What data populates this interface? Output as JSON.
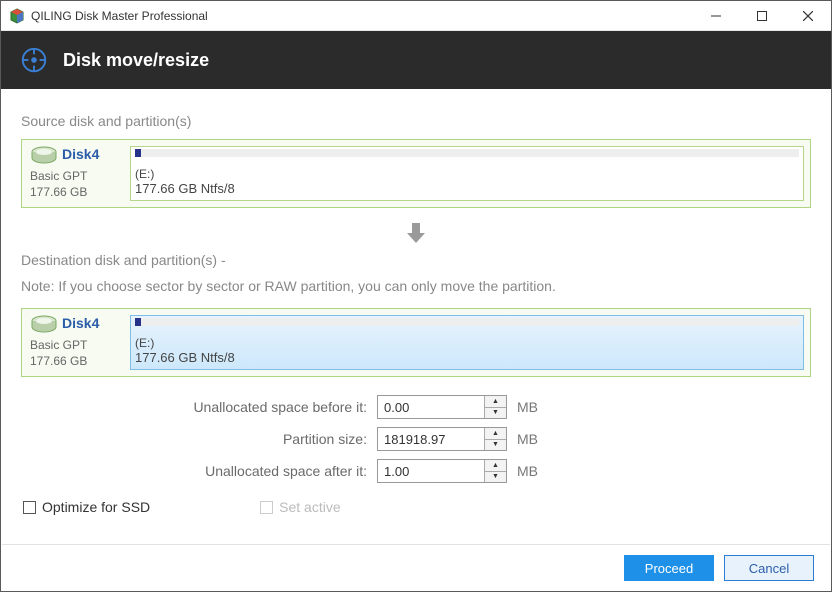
{
  "window": {
    "title": "QILING Disk Master Professional"
  },
  "header": {
    "title": "Disk move/resize"
  },
  "source": {
    "label": "Source disk and partition(s)",
    "disk": {
      "name": "Disk4",
      "type": "Basic GPT",
      "size": "177.66 GB"
    },
    "partition": {
      "letter": "(E:)",
      "desc": "177.66 GB Ntfs/8"
    }
  },
  "destination": {
    "label": "Destination disk and partition(s) -",
    "note": "Note: If you choose sector by sector or RAW partition, you can only move the partition.",
    "disk": {
      "name": "Disk4",
      "type": "Basic GPT",
      "size": "177.66 GB"
    },
    "partition": {
      "letter": "(E:)",
      "desc": "177.66 GB Ntfs/8"
    }
  },
  "fields": {
    "before_label": "Unallocated space before it:",
    "before_value": "0.00",
    "size_label": "Partition size:",
    "size_value": "181918.97",
    "after_label": "Unallocated space after it:",
    "after_value": "1.00",
    "unit": "MB"
  },
  "options": {
    "ssd_label": "Optimize for SSD",
    "active_label": "Set active"
  },
  "footer": {
    "proceed": "Proceed",
    "cancel": "Cancel"
  }
}
